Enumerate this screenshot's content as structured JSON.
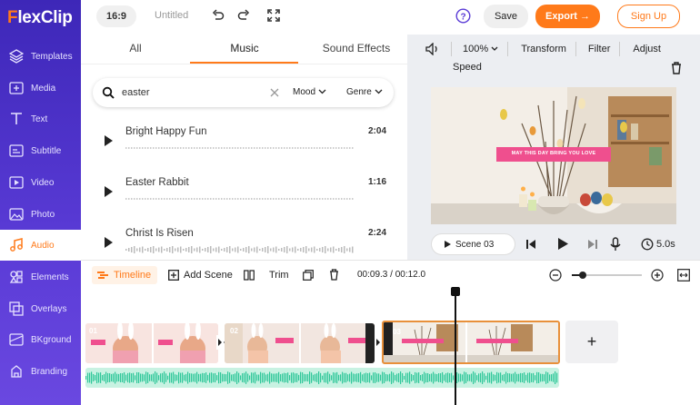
{
  "app": {
    "logo_prefix": "F",
    "logo_rest": "lexClip"
  },
  "sidebar": {
    "items": [
      {
        "label": "Templates",
        "icon": "layers-icon"
      },
      {
        "label": "Media",
        "icon": "media-plus-icon"
      },
      {
        "label": "Text",
        "icon": "text-icon"
      },
      {
        "label": "Subtitle",
        "icon": "subtitle-icon"
      },
      {
        "label": "Video",
        "icon": "video-icon"
      },
      {
        "label": "Photo",
        "icon": "photo-icon"
      },
      {
        "label": "Audio",
        "icon": "music-note-icon",
        "active": true
      },
      {
        "label": "Elements",
        "icon": "elements-icon"
      },
      {
        "label": "Overlays",
        "icon": "overlays-icon"
      },
      {
        "label": "BKground",
        "icon": "background-icon"
      },
      {
        "label": "Branding",
        "icon": "branding-icon"
      }
    ]
  },
  "topbar": {
    "aspect": "16:9",
    "title": "Untitled",
    "save": "Save",
    "export": "Export →",
    "signup": "Sign Up"
  },
  "library": {
    "tabs": [
      "All",
      "Music",
      "Sound Effects"
    ],
    "active_tab": "Music",
    "search_value": "easter",
    "mood": "Mood",
    "genre": "Genre",
    "tracks": [
      {
        "name": "Bright Happy Fun",
        "duration": "2:04"
      },
      {
        "name": "Easter Rabbit",
        "duration": "1:16"
      },
      {
        "name": "Christ Is Risen",
        "duration": "2:24"
      }
    ]
  },
  "preview": {
    "zoom": "100%",
    "transform": "Transform",
    "filter": "Filter",
    "adjust": "Adjust",
    "speed": "Speed",
    "banner_text": "MAY THIS DAY BRING YOU LOVE",
    "scene": "Scene  03",
    "duration": "5.0s"
  },
  "timeline": {
    "label": "Timeline",
    "add_scene": "Add Scene",
    "trim": "Trim",
    "time": "00:09.3 / 00:12.0",
    "clips": [
      {
        "num": "01"
      },
      {
        "num": "02"
      },
      {
        "num": "03"
      }
    ],
    "add": "+"
  },
  "colors": {
    "accent": "#ff7a1a",
    "sidebar": "#4a30c8",
    "audio_wave": "#3fd3a8"
  }
}
